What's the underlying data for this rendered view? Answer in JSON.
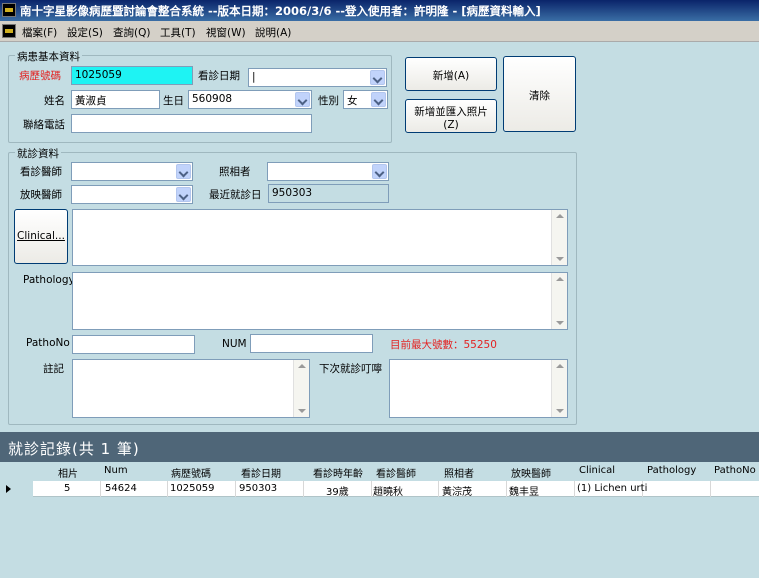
{
  "window": {
    "title": "南十字星影像病歷暨討論會整合系統 --版本日期：2006/3/6 --登入使用者：許明隆 - [病歷資料輸入]"
  },
  "menu": {
    "items": [
      "檔案(F)",
      "設定(S)",
      "查詢(Q)",
      "工具(T)",
      "視窗(W)",
      "說明(A)"
    ]
  },
  "patient": {
    "section_title": "病患基本資料",
    "chart_no_label": "病歷號碼",
    "chart_no": "1025059",
    "visit_date_label": "看診日期",
    "visit_date": "",
    "name_label": "姓名",
    "name": "黃淑貞",
    "birth_label": "生日",
    "birth": "560908",
    "gender_label": "性別",
    "gender": "女",
    "phone_label": "聯絡電話",
    "phone": ""
  },
  "buttons": {
    "add": "新增(A)",
    "add_import_line1": "新增並匯入照片",
    "add_import_line2": "(Z)",
    "clear": "清除",
    "clinical": "Clinical..."
  },
  "visit": {
    "section_title": "就診資料",
    "doctor_label": "看診醫師",
    "doctor": "",
    "photographer_label": "照相者",
    "photographer": "",
    "radiologist_label": "放映醫師",
    "radiologist": "",
    "last_visit_label": "最近就診日",
    "last_visit": "950303",
    "pathology_label": "Pathology",
    "pathono_label": "PathoNo",
    "pathono": "",
    "num_label": "NUM",
    "num": "",
    "max_no_text": "目前最大號數：55250",
    "note_label": "註記",
    "next_visit_label": "下次就診叮嚀"
  },
  "records": {
    "title": "就診記錄(共 1 筆)",
    "columns": [
      "相片",
      "Num",
      "病歷號碼",
      "看診日期",
      "看診時年齡",
      "看診醫師",
      "照相者",
      "放映醫師",
      "Clinical",
      "Pathology",
      "PathoNo"
    ],
    "rows": [
      [
        "5",
        "54624",
        "1025059",
        "950303",
        "39歲",
        "趙曉秋",
        "黃淙茂",
        "魏丰昱",
        "(1) Lichen urti",
        "",
        ""
      ]
    ]
  },
  "colors": {
    "highlight": "#1ef3f3",
    "record_header": "#4f6678",
    "max_no": "#e32222"
  }
}
